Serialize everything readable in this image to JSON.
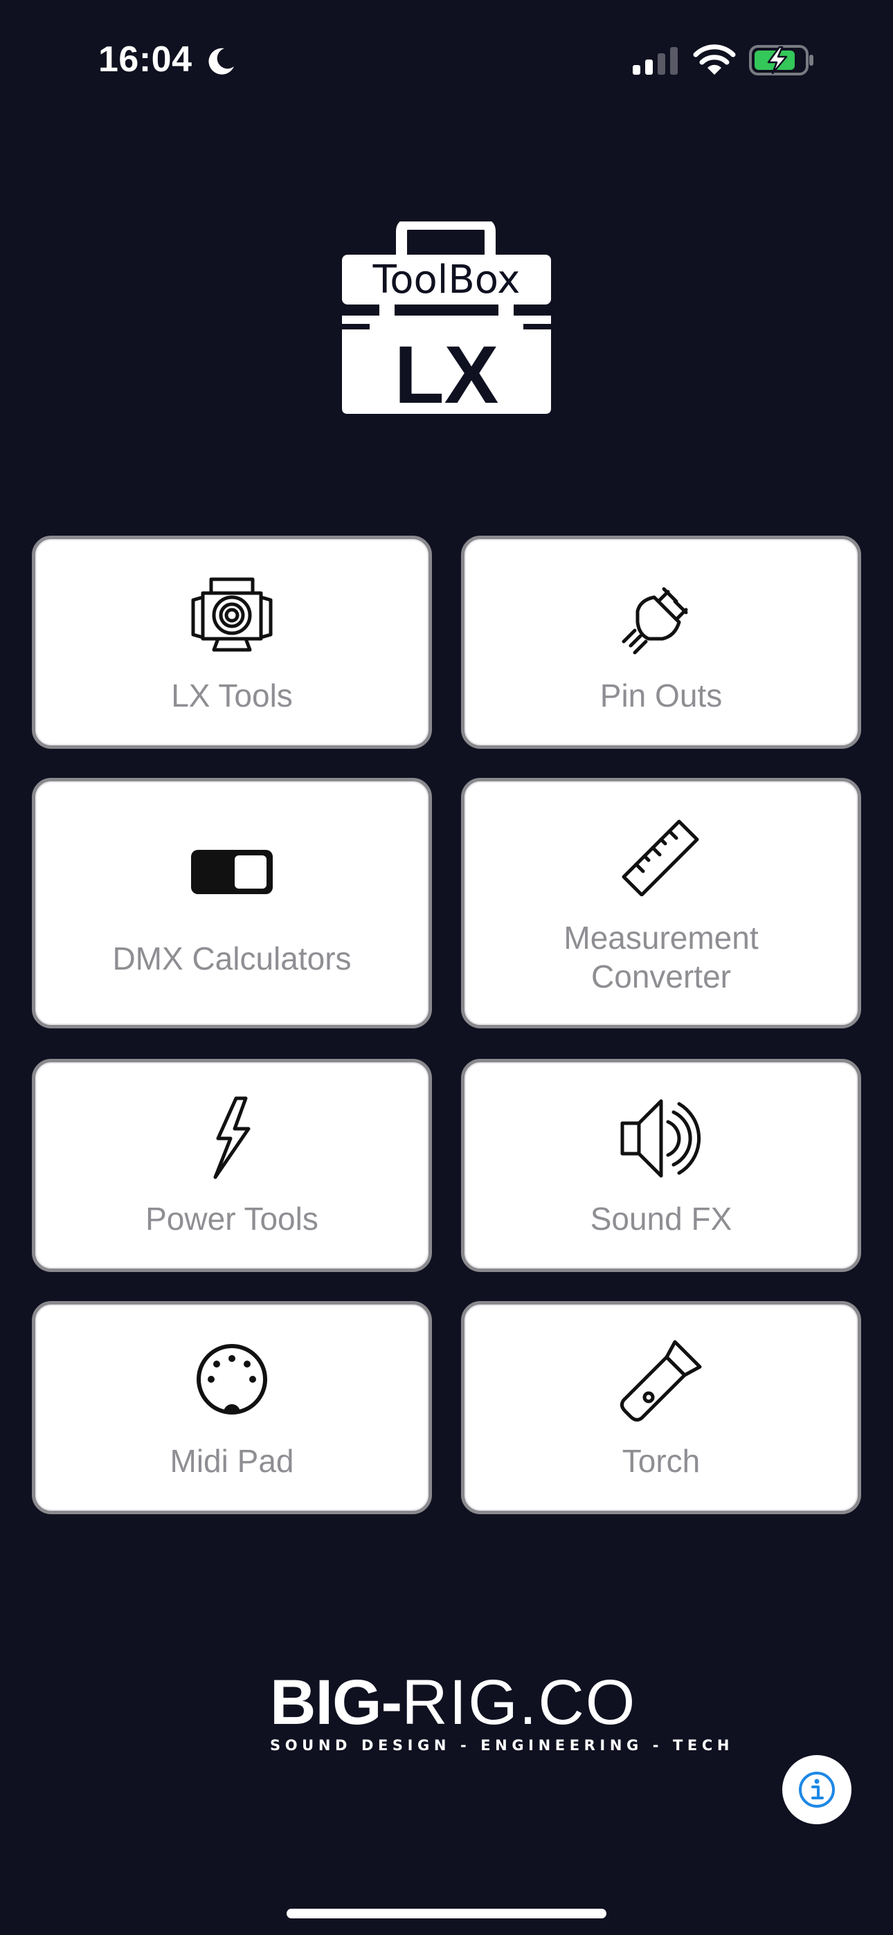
{
  "status_bar": {
    "time": "16:04",
    "icons": [
      "moon-icon",
      "cellular-signal-icon",
      "wifi-icon",
      "battery-charging-icon"
    ],
    "battery_color": "#34c759"
  },
  "logo": {
    "top_text": "ToolBox",
    "main_text": "LX"
  },
  "tiles": [
    {
      "label": "LX Tools",
      "icon": "stage-light-icon"
    },
    {
      "label": "Pin Outs",
      "icon": "power-plug-icon"
    },
    {
      "label": "DMX Calculators",
      "icon": "toggle-switch-icon"
    },
    {
      "label": "Measurement\nConverter",
      "icon": "ruler-icon"
    },
    {
      "label": "Power Tools",
      "icon": "lightning-bolt-icon"
    },
    {
      "label": "Sound FX",
      "icon": "speaker-icon"
    },
    {
      "label": "Midi Pad",
      "icon": "midi-din-connector-icon"
    },
    {
      "label": "Torch",
      "icon": "flashlight-icon"
    }
  ],
  "footer": {
    "brand_bold": "BIG-",
    "brand_light": "RIG.CO",
    "tagline": "SOUND DESIGN - ENGINEERING - TECH",
    "info_icon": "info-icon"
  },
  "colors": {
    "background": "#0f1020",
    "tile_label": "#8e8e93",
    "tile_border": "#8a8a8e",
    "info_accent": "#1e88e5"
  }
}
